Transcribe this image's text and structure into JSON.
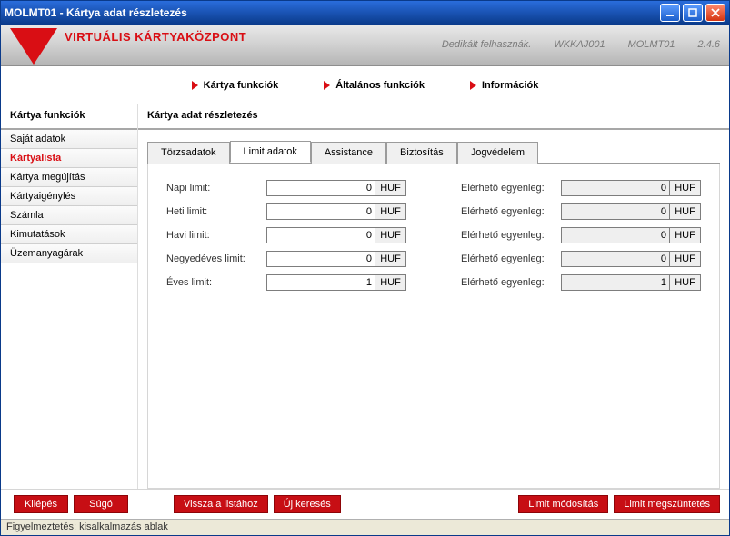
{
  "window": {
    "title": "MOLMT01 - Kártya adat részletezés"
  },
  "banner": {
    "brand": "VIRTUÁLIS KÁRTYAKÖZPONT",
    "dedicated_label": "Dedikált felhasznák.",
    "dedicated_value": "WKKAJ001",
    "terminal": "MOLMT01",
    "version": "2.4.6"
  },
  "topnav": {
    "items": [
      "Kártya funkciók",
      "Általános funkciók",
      "Információk"
    ]
  },
  "sidebar": {
    "title": "Kártya funkciók",
    "items": [
      {
        "label": "Saját adatok",
        "active": false
      },
      {
        "label": "Kártyalista",
        "active": true
      },
      {
        "label": "Kártya megújítás",
        "active": false
      },
      {
        "label": "Kártyaigénylés",
        "active": false
      },
      {
        "label": "Számla",
        "active": false
      },
      {
        "label": "Kimutatások",
        "active": false
      },
      {
        "label": "Üzemanyagárak",
        "active": false
      }
    ]
  },
  "main": {
    "title": "Kártya adat részletezés",
    "tabs": [
      {
        "label": "Törzsadatok",
        "active": false
      },
      {
        "label": "Limit adatok",
        "active": true
      },
      {
        "label": "Assistance",
        "active": false
      },
      {
        "label": "Biztosítás",
        "active": false
      },
      {
        "label": "Jogvédelem",
        "active": false
      }
    ],
    "currency": "HUF",
    "balance_label": "Elérhető egyenleg:",
    "rows": [
      {
        "label": "Napi limit:",
        "limit": "0",
        "balance": "0"
      },
      {
        "label": "Heti limit:",
        "limit": "0",
        "balance": "0"
      },
      {
        "label": "Havi limit:",
        "limit": "0",
        "balance": "0"
      },
      {
        "label": "Negyedéves limit:",
        "limit": "0",
        "balance": "0"
      },
      {
        "label": "Éves limit:",
        "limit": "1",
        "balance": "1"
      }
    ]
  },
  "footer": {
    "kilepes": "Kilépés",
    "sugo": "Súgó",
    "vissza": "Vissza a listához",
    "ujkereses": "Új keresés",
    "limit_mod": "Limit módosítás",
    "limit_del": "Limit megszüntetés"
  },
  "status": "Figyelmeztetés: kisalkalmazás ablak"
}
